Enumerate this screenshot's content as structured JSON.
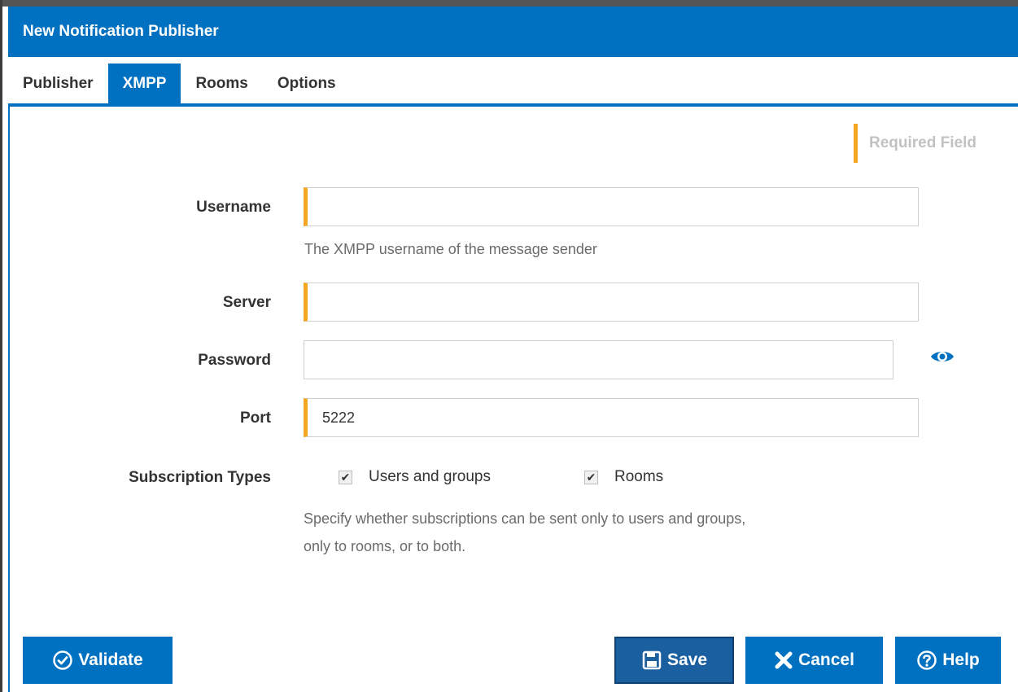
{
  "window": {
    "title": "New Notification Publisher"
  },
  "tabs": [
    {
      "label": "Publisher"
    },
    {
      "label": "XMPP",
      "active": true
    },
    {
      "label": "Rooms"
    },
    {
      "label": "Options"
    }
  ],
  "required_legend": "Required Field",
  "form": {
    "username": {
      "label": "Username",
      "value": "",
      "help": "The XMPP username of the message sender"
    },
    "server": {
      "label": "Server",
      "value": ""
    },
    "password": {
      "label": "Password",
      "value": ""
    },
    "port": {
      "label": "Port",
      "value": "5222"
    },
    "subscription_types": {
      "label": "Subscription Types",
      "options": [
        {
          "label": "Users and groups",
          "checked": true
        },
        {
          "label": "Rooms",
          "checked": true
        }
      ],
      "help_line1": "Specify whether subscriptions can be sent only to users and groups,",
      "help_line2": "only to rooms, or to both."
    }
  },
  "buttons": {
    "validate": "Validate",
    "save": "Save",
    "cancel": "Cancel",
    "help": "Help"
  },
  "colors": {
    "accent": "#0070c0",
    "required": "#f5a623"
  }
}
